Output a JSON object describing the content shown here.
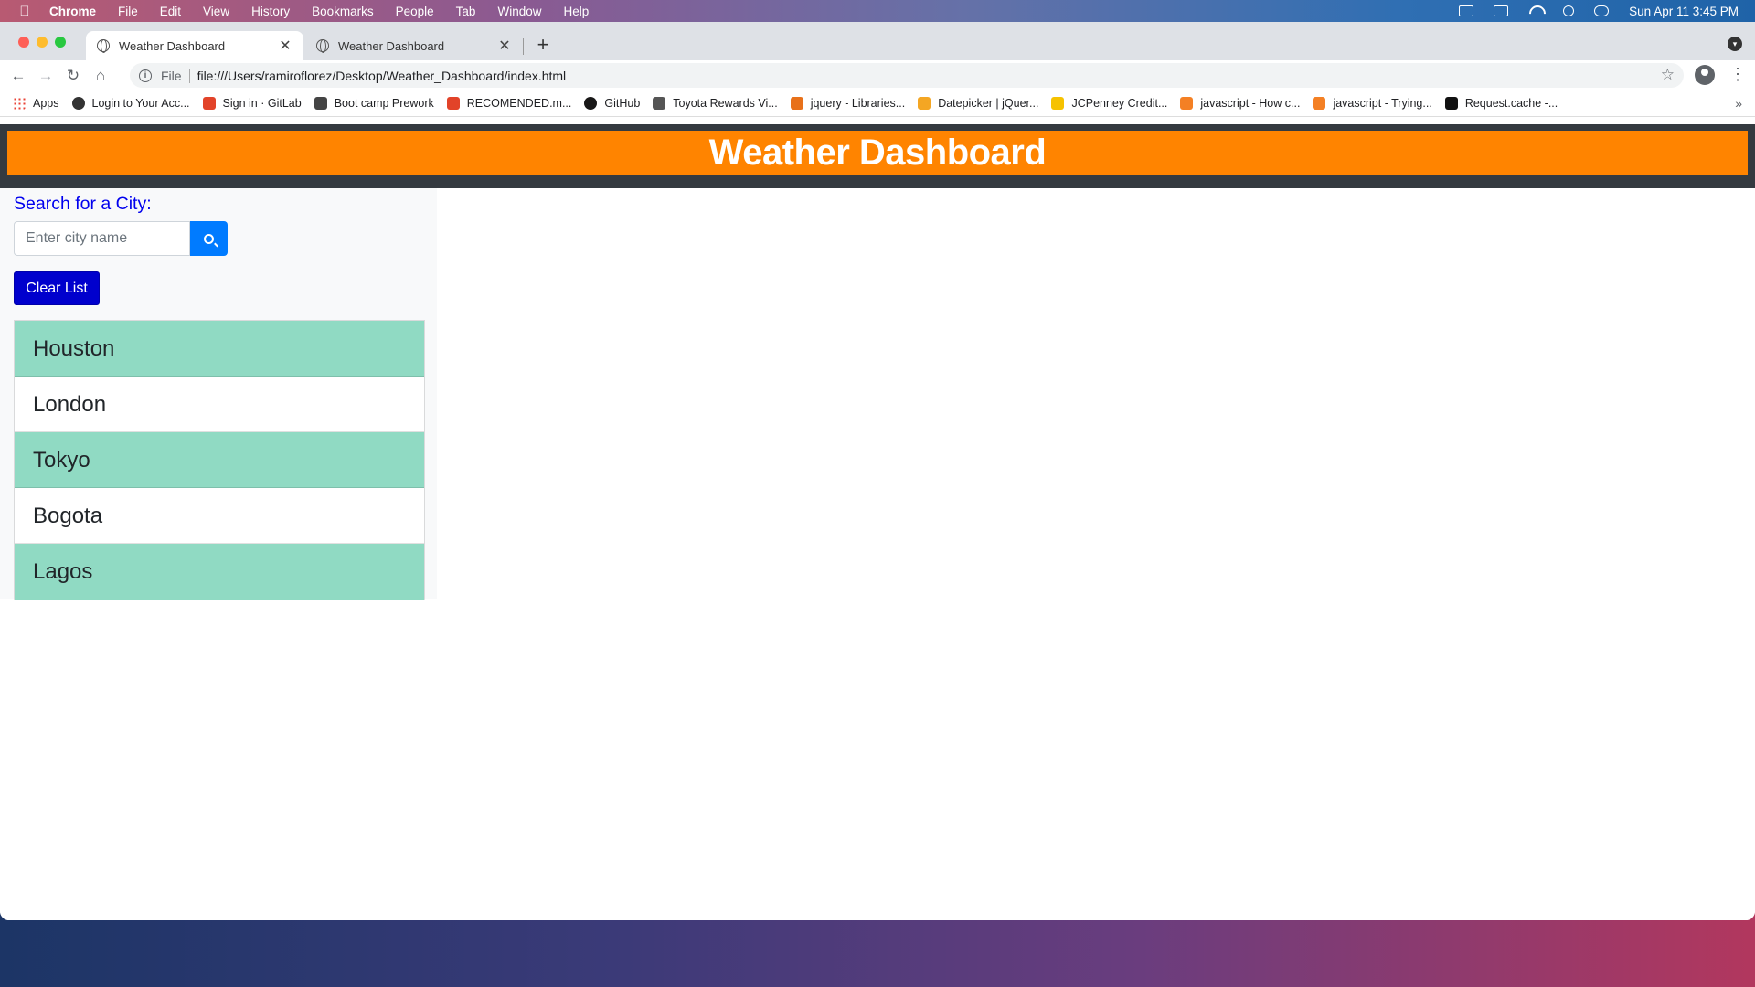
{
  "menubar": {
    "app_name": "Chrome",
    "items": [
      "File",
      "Edit",
      "View",
      "History",
      "Bookmarks",
      "People",
      "Tab",
      "Window",
      "Help"
    ],
    "clock": "Sun Apr 11  3:45 PM"
  },
  "browser": {
    "tabs": [
      {
        "title": "Weather Dashboard",
        "active": true
      },
      {
        "title": "Weather Dashboard",
        "active": false
      }
    ],
    "address": {
      "scheme_label": "File",
      "url": "file:///Users/ramiroflorez/Desktop/Weather_Dashboard/index.html"
    },
    "bookmarks": [
      {
        "label": "Apps",
        "icon": "apps-grid-icon",
        "color": "#e94235"
      },
      {
        "label": "Login to Your Acc...",
        "icon": "globe-icon",
        "color": "#333333"
      },
      {
        "label": "Sign in · GitLab",
        "icon": "gitlab-icon",
        "color": "#e24329"
      },
      {
        "label": "Boot camp Prework",
        "icon": "book-icon",
        "color": "#444444"
      },
      {
        "label": "RECOMENDED.m...",
        "icon": "gitlab-icon",
        "color": "#e24329"
      },
      {
        "label": "GitHub",
        "icon": "github-icon",
        "color": "#181717"
      },
      {
        "label": "Toyota Rewards Vi...",
        "icon": "card-icon",
        "color": "#555555"
      },
      {
        "label": "jquery - Libraries...",
        "icon": "code-icon",
        "color": "#e8711a"
      },
      {
        "label": "Datepicker | jQuer...",
        "icon": "shield-icon",
        "color": "#f4a623"
      },
      {
        "label": "JCPenney Credit...",
        "icon": "jcp-icon",
        "color": "#f6c200"
      },
      {
        "label": "javascript - How c...",
        "icon": "stackoverflow-icon",
        "color": "#f48024"
      },
      {
        "label": "javascript - Trying...",
        "icon": "stackoverflow-icon",
        "color": "#f48024"
      },
      {
        "label": "Request.cache -...",
        "icon": "mdn-icon",
        "color": "#111111"
      }
    ]
  },
  "page": {
    "header_title": "Weather Dashboard",
    "search_label": "Search for a City:",
    "search_placeholder": "Enter city name",
    "clear_label": "Clear List",
    "cities": [
      "Houston",
      "London",
      "Tokyo",
      "Bogota",
      "Lagos"
    ],
    "colors": {
      "header_bg": "#ff8400",
      "header_frame": "#343a40",
      "search_button": "#007bff",
      "clear_button": "#0000cd",
      "list_alt": "#90dac3",
      "label": "#0000ee"
    }
  }
}
